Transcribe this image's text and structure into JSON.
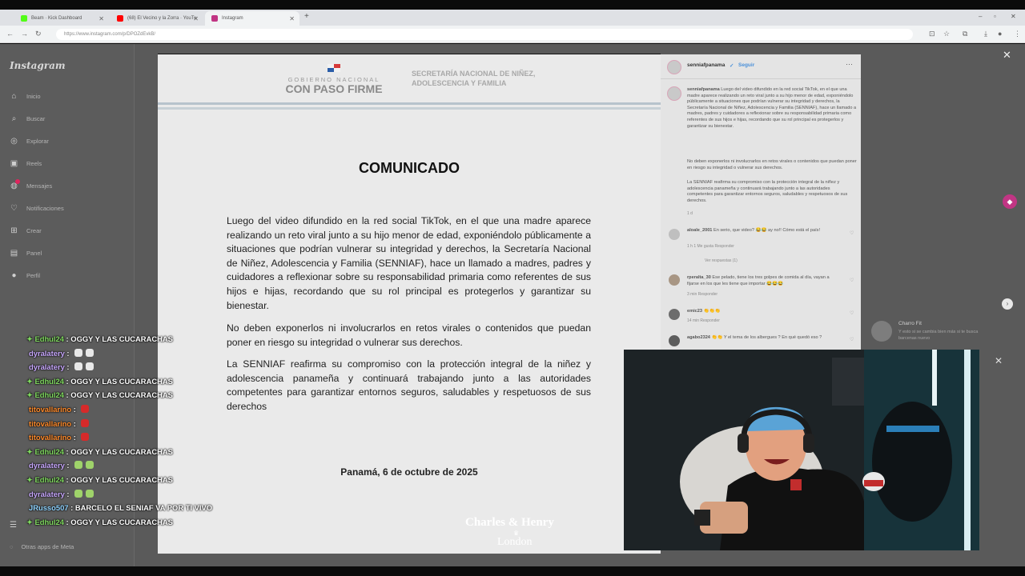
{
  "browser": {
    "tabs": [
      {
        "title": "Beam · Kick Dashboard",
        "favicon_color": "#53fc18"
      },
      {
        "title": "(68) El Vecino y la Zorra · YouTu",
        "favicon_color": "#ff0000"
      },
      {
        "title": "Instagram",
        "favicon_color": "#c13584"
      }
    ],
    "url": "https://www.instagram.com/p/DPOZdEvkB/"
  },
  "instagram": {
    "logo": "Instagram",
    "nav": [
      {
        "label": "Inicio",
        "icon": "home-icon",
        "glyph": "⌂"
      },
      {
        "label": "Buscar",
        "icon": "search-icon",
        "glyph": "⌕"
      },
      {
        "label": "Explorar",
        "icon": "compass-icon",
        "glyph": "◎"
      },
      {
        "label": "Reels",
        "icon": "reels-icon",
        "glyph": "▣"
      },
      {
        "label": "Mensajes",
        "icon": "messenger-icon",
        "glyph": "◍"
      },
      {
        "label": "Notificaciones",
        "icon": "heart-icon",
        "glyph": "♡"
      },
      {
        "label": "Crear",
        "icon": "plus-icon",
        "glyph": "⊞"
      },
      {
        "label": "Panel",
        "icon": "dashboard-icon",
        "glyph": "▤"
      },
      {
        "label": "Perfil",
        "icon": "profile-icon",
        "glyph": "●"
      }
    ],
    "more_label": "Otras apps de Meta",
    "suggestion": {
      "name": "Charro Fit",
      "sub": "Y esto si se cambia bien más si te busca barcenas nuevo"
    }
  },
  "document": {
    "gov_line1": "GOBIERNO NACIONAL",
    "gov_line2": "CON PASO FIRME",
    "secretaria": "SECRETARÍA NACIONAL DE NIÑEZ, ADOLESCENCIA Y FAMILIA",
    "title": "COMUNICADO",
    "paragraphs": [
      "Luego del video difundido en la red social TikTok, en el que una madre aparece realizando un reto viral junto a su hijo menor de edad, exponiéndolo públicamente a situaciones que podrían vulnerar su integridad y derechos, la Secretaría Nacional de Niñez, Adolescencia y Familia (SENNIAF), hace un llamado a madres, padres y cuidadores a reflexionar sobre su responsabilidad primaria como referentes de sus hijos e hijas, recordando que su rol principal es protegerlos y garantizar su bienestar.",
      "No deben exponerlos ni involucrarlos en retos virales o contenidos que puedan poner en riesgo su integridad o vulnerar sus derechos.",
      "La SENNIAF reafirma su compromiso con la protección integral de la niñez y adolescencia panameña y continuará trabajando junto a las autoridades competentes para garantizar entornos seguros, saludables y respetuosos de sus derechos"
    ],
    "footer": "Panamá, 6 de octubre de 2025",
    "watermark1": "Charles & Henry",
    "watermark2": "London"
  },
  "post": {
    "username": "senniafpanama",
    "follow": "Seguir",
    "verified": "✓",
    "caption_p1": "Luego del video difundido en la red social TikTok, en el que una madre aparece realizando un reto viral junto a su hijo menor de edad, exponiéndolo públicamente a situaciones que podrían vulnerar su integridad y derechos, la Secretaría Nacional de Niñez, Adolescencia y Familia (SENNIAF), hace un llamado a madres, padres y cuidadores a reflexionar sobre su responsabilidad primaria como referentes de sus hijos e hijas, recordando que su rol principal es protegerlos y garantizar su bienestar.",
    "caption_p2": "No deben exponerlos ni involucrarlos en retos virales o contenidos que puedan poner en riesgo su integridad o vulnerar sus derechos.",
    "caption_p3": "La SENNIAF reafirma su compromiso con la protección integral de la niñez y adolescencia panameña y continuará trabajando junto a las autoridades competentes para garantizar entornos seguros, saludables y respetuosos de sus derechos.",
    "caption_time": "1 d",
    "comments": [
      {
        "user": "aloale_2001",
        "text": "En serio, que video? 😂😂 ay no!! Cómo está el país!",
        "meta": "1 h   1 Me gusta   Responder",
        "replies": "Ver respuestas (1)"
      },
      {
        "user": "rperalta_30",
        "text": "Ese pelado, tiene los tres golpes de comida al día, vayan a fijarse en los que les tiene que importar 😂😂😂",
        "meta": "3 min   Responder"
      },
      {
        "user": "emic23",
        "text": "👏👏👏",
        "meta": "14 min   Responder"
      },
      {
        "user": "agabo2324",
        "text": "👏👏 Y el tema de los albergues ? En qué quedó eso ?",
        "meta": ""
      }
    ]
  },
  "chat": [
    {
      "user": "Edhul24",
      "star": true,
      "text": "OGGY Y LAS CUCARACHAS",
      "cls": "u-edhul"
    },
    {
      "user": "dyralatery",
      "star": false,
      "emotes": [
        "#e8e8e8",
        "#e8e8e8"
      ],
      "cls": "u-dyra"
    },
    {
      "user": "dyralatery",
      "star": false,
      "emotes": [
        "#e8e8e8",
        "#e8e8e8"
      ],
      "cls": "u-dyra"
    },
    {
      "user": "Edhul24",
      "star": true,
      "text": "OGGY Y LAS CUCARACHAS",
      "cls": "u-edhul"
    },
    {
      "user": "Edhul24",
      "star": true,
      "text": "OGGY Y LAS CUCARACHAS",
      "cls": "u-edhul"
    },
    {
      "user": "titovallarino",
      "star": false,
      "emotes": [
        "#d62a2a"
      ],
      "cls": "u-tito"
    },
    {
      "user": "titovallarino",
      "star": false,
      "emotes": [
        "#d62a2a"
      ],
      "cls": "u-tito"
    },
    {
      "user": "titovallarino",
      "star": false,
      "emotes": [
        "#d62a2a"
      ],
      "cls": "u-tito"
    },
    {
      "user": "Edhul24",
      "star": true,
      "text": "OGGY Y LAS CUCARACHAS",
      "cls": "u-edhul"
    },
    {
      "user": "dyralatery",
      "star": false,
      "emotes": [
        "#9fd36a",
        "#9fd36a"
      ],
      "cls": "u-dyra"
    },
    {
      "user": "Edhul24",
      "star": true,
      "text": "OGGY Y LAS CUCARACHAS",
      "cls": "u-edhul"
    },
    {
      "user": "dyralatery",
      "star": false,
      "emotes": [
        "#9fd36a",
        "#9fd36a"
      ],
      "cls": "u-dyra"
    },
    {
      "user": "JRusso507",
      "star": false,
      "text": "BARCELO EL SENIAF VA POR TI VIVO",
      "cls": "u-jr"
    },
    {
      "user": "Edhul24",
      "star": true,
      "text": "OGGY Y LAS CUCARACHAS",
      "cls": "u-edhul"
    }
  ]
}
